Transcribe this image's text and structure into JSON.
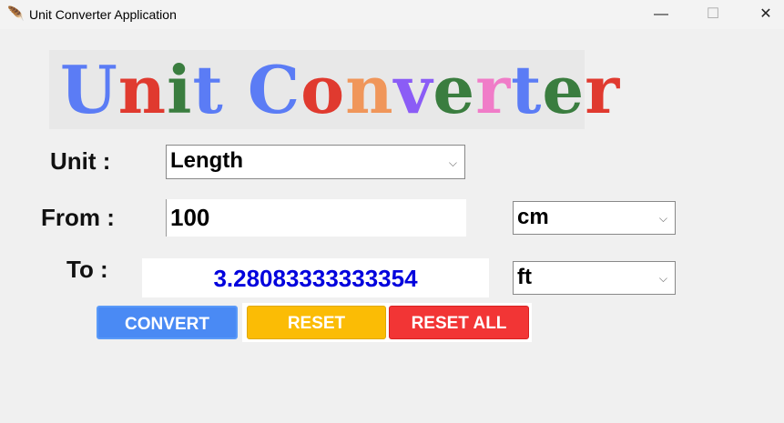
{
  "window": {
    "title": "Unit Converter Application",
    "icon": "feather-icon"
  },
  "logo": {
    "text": "Unit Converter",
    "letters": [
      {
        "ch": "U",
        "color": "#5b7cf5"
      },
      {
        "ch": "n",
        "color": "#e03a2f"
      },
      {
        "ch": "i",
        "color": "#3a7d3f"
      },
      {
        "ch": "t",
        "color": "#5b7cf5"
      },
      {
        "ch": " ",
        "color": "#000"
      },
      {
        "ch": "C",
        "color": "#5b7cf5"
      },
      {
        "ch": "o",
        "color": "#e03a2f"
      },
      {
        "ch": "n",
        "color": "#f0965a"
      },
      {
        "ch": "v",
        "color": "#8b5cf6"
      },
      {
        "ch": "e",
        "color": "#3a7d3f"
      },
      {
        "ch": "r",
        "color": "#f07cc8"
      },
      {
        "ch": "t",
        "color": "#5b7cf5"
      },
      {
        "ch": "e",
        "color": "#3a7d3f"
      },
      {
        "ch": "r",
        "color": "#e03a2f"
      }
    ]
  },
  "form": {
    "unit_label": "Unit :",
    "unit_value": "Length",
    "from_label": "From :",
    "from_value": "100",
    "from_unit": "cm",
    "to_label": "To :",
    "to_value": "3.28083333333354",
    "to_unit": "ft"
  },
  "buttons": {
    "convert": "CONVERT",
    "reset": "RESET",
    "reset_all": "RESET ALL",
    "colors": {
      "convert": "#4a8af4",
      "reset": "#fbbc05",
      "reset_all": "#f23535"
    }
  }
}
